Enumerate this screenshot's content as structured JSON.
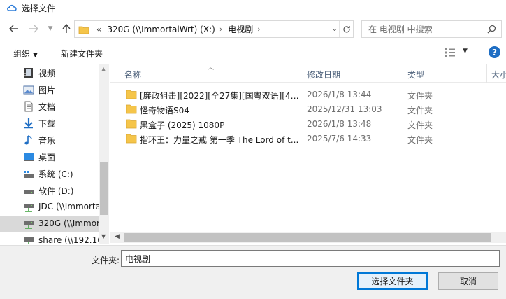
{
  "window": {
    "title": "选择文件"
  },
  "address": {
    "overflow": "«",
    "crumbs": [
      {
        "label": "320G (\\\\ImmortalWrt) (X:)"
      },
      {
        "label": "电视剧"
      }
    ]
  },
  "search": {
    "placeholder": "在 电视剧 中搜索"
  },
  "toolbar": {
    "organize": "组织",
    "new_folder": "新建文件夹",
    "help": "?"
  },
  "sidebar": {
    "items": [
      {
        "label": "视频",
        "icon": "video-icon"
      },
      {
        "label": "图片",
        "icon": "pictures-icon"
      },
      {
        "label": "文档",
        "icon": "documents-icon"
      },
      {
        "label": "下载",
        "icon": "downloads-icon"
      },
      {
        "label": "音乐",
        "icon": "music-icon"
      },
      {
        "label": "桌面",
        "icon": "desktop-icon"
      },
      {
        "label": "系统 (C:)",
        "icon": "system-drive-icon"
      },
      {
        "label": "软件 (D:)",
        "icon": "drive-icon"
      },
      {
        "label": "JDC (\\\\Immorta",
        "icon": "network-drive-icon"
      },
      {
        "label": "320G (\\\\Immor",
        "icon": "network-drive-icon"
      },
      {
        "label": "share (\\\\192.16",
        "icon": "network-drive-icon"
      }
    ],
    "selected_index": 9
  },
  "columns": {
    "name": "名称",
    "modified": "修改日期",
    "type": "类型",
    "size": "大小"
  },
  "files": [
    {
      "name": "[廉政狙击][2022][全27集][国粤双语][4K ...",
      "modified": "2026/1/8 13:44",
      "type": "文件夹"
    },
    {
      "name": "怪奇物语S04",
      "modified": "2025/12/31 13:03",
      "type": "文件夹"
    },
    {
      "name": "黑盒子 (2025) 1080P",
      "modified": "2026/1/8 13:48",
      "type": "文件夹"
    },
    {
      "name": "指环王：力量之戒 第一季 The Lord of t...",
      "modified": "2025/7/6 14:33",
      "type": "文件夹"
    }
  ],
  "footer": {
    "folder_label": "文件夹:",
    "folder_value": "电视剧",
    "select_button": "选择文件夹",
    "cancel_button": "取消"
  },
  "colors": {
    "accent": "#0078d7",
    "folder": "#f5c54a",
    "selected_nav": "#d9d9d9"
  }
}
